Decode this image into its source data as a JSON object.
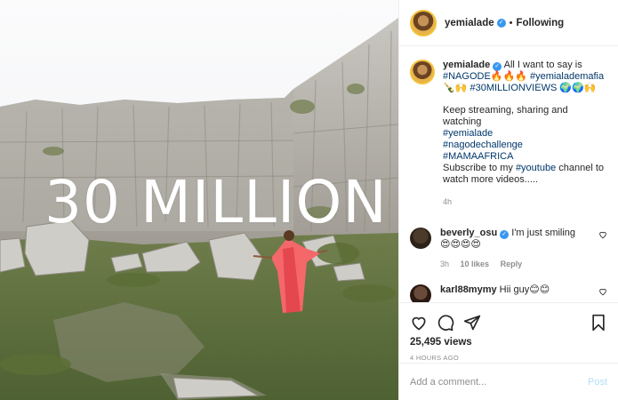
{
  "media": {
    "overlay_text": "30 MILLION"
  },
  "header": {
    "username": "yemialade",
    "dot": "•",
    "follow_label": "Following"
  },
  "caption": {
    "username": "yemialade",
    "line1": "All I want to say is",
    "tag_nagode": "#NAGODE",
    "emoji1": "🔥🔥🔥",
    "tag_mafia": "#yemialademafia",
    "emoji2": "🍾🙌",
    "tag_views": "#30MILLIONVIEWS",
    "emoji3": "🌍🌍🙌",
    "para2_text": "Keep streaming, sharing and watching",
    "tag_yemi": "#yemialade",
    "tag_challenge": "#nagodechallenge",
    "tag_africa": "#MAMAAFRICA",
    "para2_sub_a": "Subscribe to my",
    "tag_youtube": "#youtube",
    "para2_sub_b": "channel to watch more videos.....",
    "time": "4h"
  },
  "comments": [
    {
      "username": "beverly_osu",
      "text": "I'm just smiling",
      "emoji": "😍😍😍😍",
      "time": "3h",
      "likes": "10 likes",
      "reply": "Reply"
    },
    {
      "username": "karl88mymy",
      "text": "Hii guy",
      "emoji": "😊😊"
    }
  ],
  "actions": {
    "views": "25,495 views",
    "ago": "4 HOURS AGO"
  },
  "add_comment": {
    "placeholder": "Add a comment...",
    "post_label": "Post"
  }
}
